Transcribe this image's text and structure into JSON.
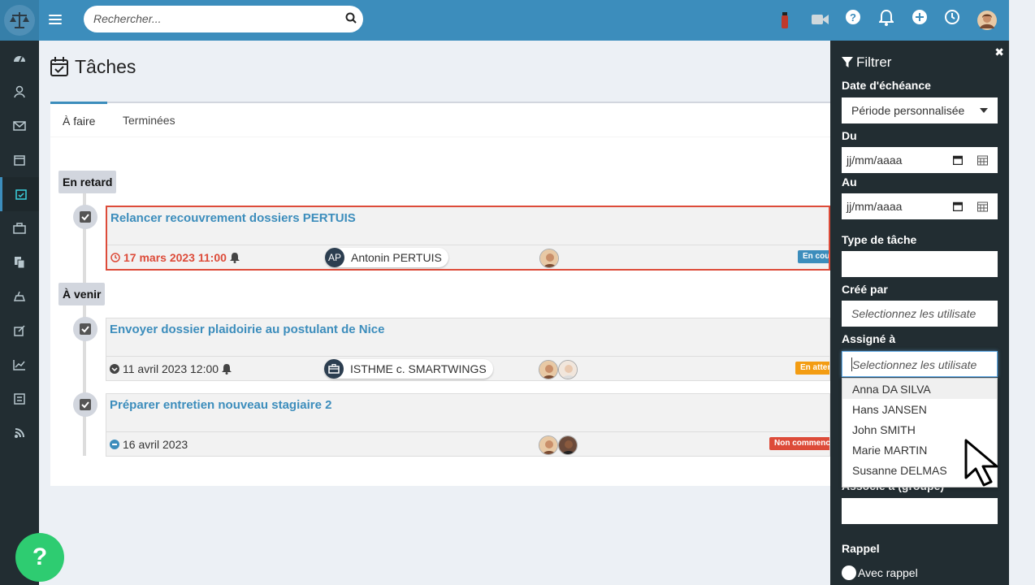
{
  "header": {
    "search_placeholder": "Rechercher..."
  },
  "page": {
    "title": "Tâches"
  },
  "tabs": [
    {
      "label": "À faire"
    },
    {
      "label": "Terminées"
    }
  ],
  "sections": {
    "overdue": "En retard",
    "upcoming": "À venir"
  },
  "tasks": [
    {
      "title": "Relancer recouvrement dossiers PERTUIS",
      "due": "17 mars 2023 11:00",
      "chip_initials": "AP",
      "chip_label": "Antonin PERTUIS",
      "status": "En cours"
    },
    {
      "title": "Envoyer dossier plaidoirie au postulant de Nice",
      "due": "11 avril 2023 12:00",
      "chip_label": "ISTHME c. SMARTWINGS",
      "status": "En attente"
    },
    {
      "title": "Préparer entretien nouveau stagiaire 2",
      "due": "16 avril 2023",
      "status": "Non commencé"
    }
  ],
  "filter": {
    "title": "Filtrer",
    "due_date_label": "Date d'échéance",
    "due_date_value": "Période personnalisée",
    "from_label": "Du",
    "from_placeholder": "jj/mm/aaaa",
    "to_label": "Au",
    "to_placeholder": "jj/mm/aaaa",
    "type_label": "Type de tâche",
    "created_by_label": "Créé par",
    "created_by_placeholder": "Selectionnez les utilisate",
    "assigned_label": "Assigné à",
    "assigned_placeholder": "Selectionnez les utilisate",
    "assigned_group_label": "Associé à (groupe)",
    "reminder_label": "Rappel",
    "reminder_option": "Avec rappel"
  },
  "assignee_options": [
    "Anna DA SILVA",
    "Hans JANSEN",
    "John SMITH",
    "Marie MARTIN",
    "Susanne DELMAS"
  ],
  "colors": {
    "primary": "#3c8dbc",
    "danger": "#dd4b39",
    "warning": "#f39c12",
    "info": "#3c8dbc",
    "sidebar": "#222d32",
    "help": "#2ecc71"
  }
}
